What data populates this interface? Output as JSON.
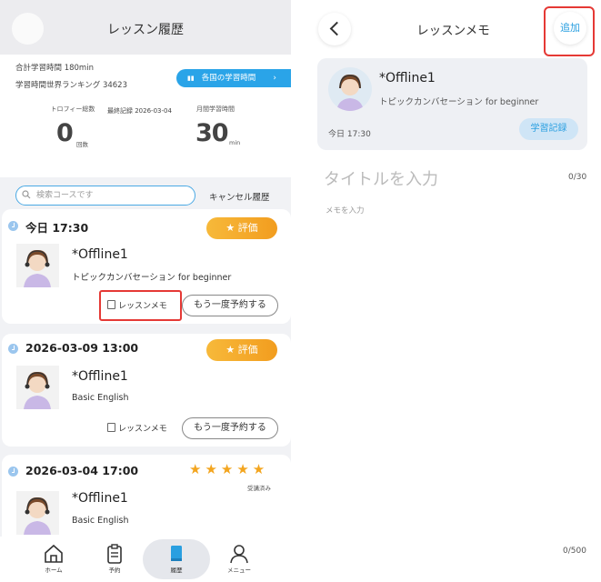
{
  "history": {
    "title": "レッスン履歴",
    "total_study": "合計学習時間  180min",
    "world_ranking": "学習時間世界ランキング  34623",
    "countries_btn": "各国の学習時間",
    "trophy_label": "トロフィー総数",
    "trophy_value": "0",
    "trophy_unit": "回数",
    "monthly_label": "月間学習時間",
    "monthly_value": "30",
    "monthly_unit": "min",
    "last_record": "最終記録  2026-03-04",
    "search_placeholder": "検索コースです",
    "cancel_history": "キャンセル履歴",
    "rate_label": "評価",
    "memo_label": "レッスンメモ",
    "rebook_label": "もう一度予約する",
    "taken_label": "受講済み",
    "lessons": [
      {
        "date": "今日 17:30",
        "teacher": "*Offline1",
        "course": "トピックカンバセーション for beginner"
      },
      {
        "date": "2026-03-09 13:00",
        "teacher": "*Offline1",
        "course": "Basic English"
      },
      {
        "date": "2026-03-04 17:00",
        "teacher": "*Offline1",
        "course": "Basic English",
        "stars": 5
      }
    ]
  },
  "tabs": [
    {
      "label": "ホーム",
      "icon": "home-icon"
    },
    {
      "label": "予約",
      "icon": "clipboard-icon"
    },
    {
      "label": "履歴",
      "icon": "book-icon",
      "active": true
    },
    {
      "label": "メニュー",
      "icon": "person-icon"
    }
  ],
  "memo": {
    "title": "レッスンメモ",
    "add": "追加",
    "teacher": "*Offline1",
    "course": "トピックカンバセーション for beginner",
    "time": "今日 17:30",
    "study_record": "学習記録",
    "title_placeholder": "タイトルを入力",
    "title_count": "0/30",
    "memo_placeholder": "メモを入力",
    "memo_count": "0/500"
  },
  "colors": {
    "accent": "#2aa4e8",
    "rate_orange": "#f29d1f",
    "highlight_red": "#e53935"
  }
}
